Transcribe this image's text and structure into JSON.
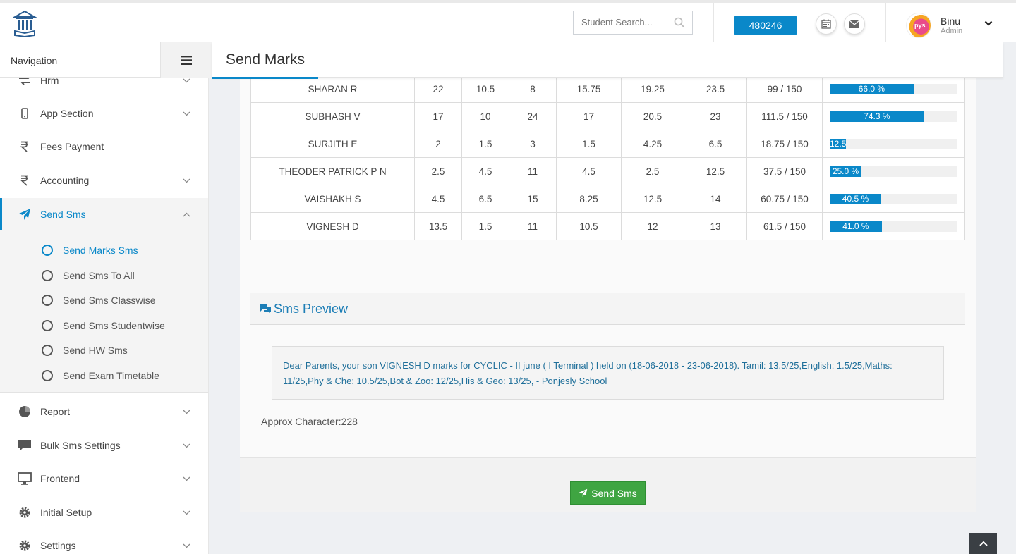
{
  "header": {
    "search_placeholder": "Student Search...",
    "id_badge": "480246",
    "user": {
      "name": "Binu",
      "role": "Admin",
      "avatar_text": "pys"
    }
  },
  "nav": {
    "title": "Navigation",
    "items": [
      {
        "label": "Hrm",
        "icon": "hrm-icon"
      },
      {
        "label": "App Section",
        "icon": "mobile-icon"
      },
      {
        "label": "Fees Payment",
        "icon": "rupee-icon"
      },
      {
        "label": "Accounting",
        "icon": "rupee-icon"
      },
      {
        "label": "Send Sms",
        "icon": "paper-plane-icon"
      },
      {
        "label": "Report",
        "icon": "pie-chart-icon"
      },
      {
        "label": "Bulk Sms Settings",
        "icon": "comment-icon"
      },
      {
        "label": "Frontend",
        "icon": "desktop-icon"
      },
      {
        "label": "Initial Setup",
        "icon": "gear-icon"
      },
      {
        "label": "Settings",
        "icon": "gear-icon"
      }
    ],
    "sub_items": [
      "Send Marks Sms",
      "Send Sms To All",
      "Send Sms Classwise",
      "Send Sms Studentwise",
      "Send HW Sms",
      "Send Exam Timetable"
    ]
  },
  "page": {
    "title": "Send Marks"
  },
  "marks_table": {
    "rows": [
      {
        "name": "SHARAN R",
        "scores": [
          "22",
          "10.5",
          "8",
          "15.75",
          "19.25",
          "23.5"
        ],
        "total": "99 / 150",
        "percent": 66.0,
        "percent_label": "66.0 %"
      },
      {
        "name": "SUBHASH V",
        "scores": [
          "17",
          "10",
          "24",
          "17",
          "20.5",
          "23"
        ],
        "total": "111.5 / 150",
        "percent": 74.3,
        "percent_label": "74.3 %"
      },
      {
        "name": "SURJITH E",
        "scores": [
          "2",
          "1.5",
          "3",
          "1.5",
          "4.25",
          "6.5"
        ],
        "total": "18.75 / 150",
        "percent": 12.5,
        "percent_label": "12.5"
      },
      {
        "name": "THEODER PATRICK P N",
        "scores": [
          "2.5",
          "4.5",
          "11",
          "4.5",
          "2.5",
          "12.5"
        ],
        "total": "37.5 / 150",
        "percent": 25.0,
        "percent_label": "25.0 %"
      },
      {
        "name": "VAISHAKH S",
        "scores": [
          "4.5",
          "6.5",
          "15",
          "8.25",
          "12.5",
          "14"
        ],
        "total": "60.75 / 150",
        "percent": 40.5,
        "percent_label": "40.5 %"
      },
      {
        "name": "VIGNESH D",
        "scores": [
          "13.5",
          "1.5",
          "11",
          "10.5",
          "12",
          "13"
        ],
        "total": "61.5 / 150",
        "percent": 41.0,
        "percent_label": "41.0 %"
      }
    ]
  },
  "sms_preview": {
    "title": "Sms Preview",
    "message": "Dear Parents, your son VIGNESH D marks for CYCLIC - II june ( I Terminal ) held on (18-06-2018 - 23-06-2018). Tamil: 13.5/25,English: 1.5/25,Maths: 11/25,Phy & Che: 10.5/25,Bot & Zoo: 12/25,His & Geo: 13/25, - Ponjesly School",
    "approx_label": "Approx Character:228"
  },
  "actions": {
    "send_label": "Send Sms"
  },
  "colors": {
    "primary": "#0a88c9",
    "success": "#3fa542",
    "sms_text": "#1f6f9a"
  }
}
